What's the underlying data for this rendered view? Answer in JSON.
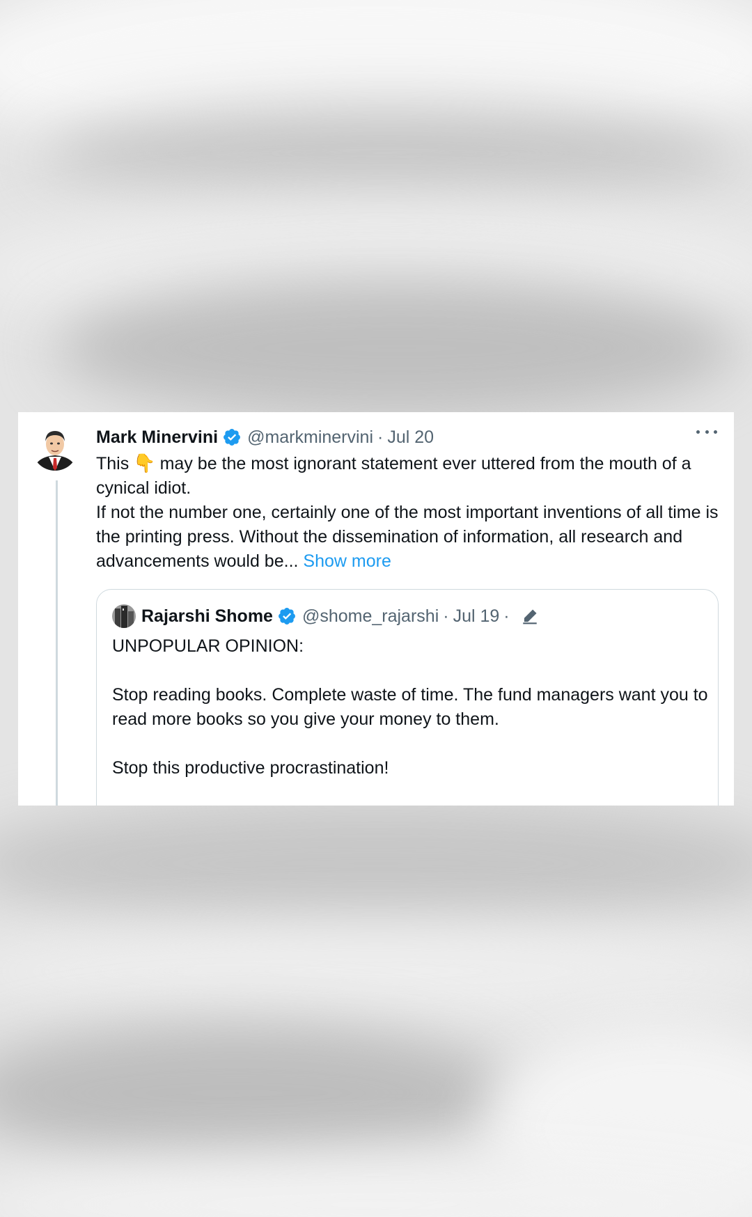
{
  "tweet": {
    "author_name": "Mark Minervini",
    "handle": "@markminervini",
    "separator": "·",
    "date": "Jul 20",
    "text_before_emoji": "This",
    "emoji": "👇",
    "text_after_emoji": "may be the most ignorant statement ever uttered from the mouth of a cynical idiot.",
    "paragraph2": "If not the number one, certainly one of the most important inventions of all time is the printing press. Without the dissemination of information, all research and advancements would be...",
    "show_more": "Show more"
  },
  "quoted_tweet": {
    "author_name": "Rajarshi Shome",
    "handle": "@shome_rajarshi",
    "separator": "·",
    "date": "Jul 19",
    "separator2": "·",
    "line1": "UNPOPULAR OPINION:",
    "line2": "Stop reading books. Complete waste of time. The fund managers want you to read more books so you give your money to them.",
    "line3": "Stop this productive procrastination!"
  },
  "colors": {
    "verified": "#1d9bf0",
    "link": "#1d9bf0",
    "secondary_text": "#536471",
    "primary_text": "#0f1419"
  },
  "icons": [
    "verified-badge-icon",
    "more-options-icon",
    "edit-pencil-icon"
  ]
}
